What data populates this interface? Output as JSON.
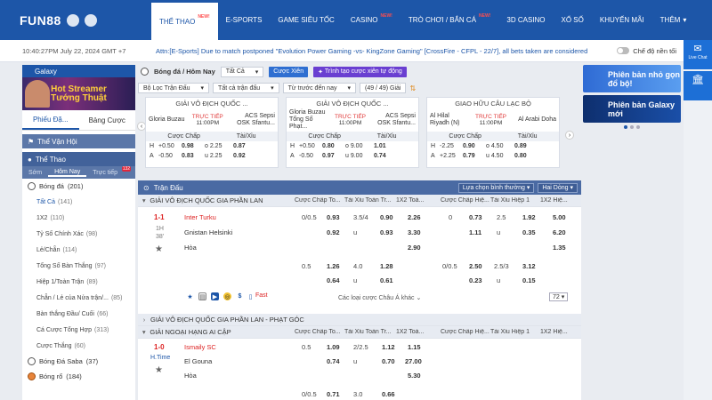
{
  "brand": {
    "logo": "FUN88"
  },
  "nav": [
    {
      "label": "THỂ THAO",
      "new": "NEW!"
    },
    {
      "label": "E-SPORTS",
      "new": ""
    },
    {
      "label": "GAME SIÊU TỐC",
      "new": ""
    },
    {
      "label": "CASINO",
      "new": "NEW!"
    },
    {
      "label": "TRÒ CHƠI / BẮN CÁ",
      "new": "NEW!"
    },
    {
      "label": "3D CASINO",
      "new": ""
    },
    {
      "label": "XỔ SỐ",
      "new": ""
    },
    {
      "label": "KHUYẾN MÃI",
      "new": ""
    },
    {
      "label": "THÊM",
      "new": ""
    }
  ],
  "info": {
    "clock": "10:40:27PM July 22, 2024 GMT +7",
    "marquee": "Attn:[E-Sports] Due to match postponed \"Evolution Power Gaming -vs- KingZone Gaming\" [CrossFire - CFPL - 22/7], all bets taken are considered",
    "toggle_label": "Chế độ nền tối"
  },
  "rail": [
    {
      "label": "Live Chat"
    },
    {
      "label": ""
    }
  ],
  "left": {
    "galaxy": "Galaxy",
    "banner": [
      "Hot Streamer",
      "Tướng Thuật"
    ],
    "tabs": [
      "Phiếu Đặ...",
      "Bảng Cược"
    ],
    "section1": "Thể Vận Hội",
    "section2": "Thể Thao",
    "subtabs": [
      "Sớm",
      "Hôm Nay",
      "Trực tiếp"
    ],
    "badge": "132",
    "sport1": {
      "label": "Bóng đá",
      "count": "(201)"
    },
    "items": [
      {
        "label": "Tất Cả",
        "count": "(141)"
      },
      {
        "label": "1X2",
        "count": "(110)"
      },
      {
        "label": "Tỷ Số Chính Xác",
        "count": "(98)"
      },
      {
        "label": "Lẻ/Chẵn",
        "count": "(114)"
      },
      {
        "label": "Tổng Số Bàn Thắng",
        "count": "(97)"
      },
      {
        "label": "Hiệp 1/Toàn Trận",
        "count": "(89)"
      },
      {
        "label": "Chẵn / Lẻ của Nửa trận/...",
        "count": "(85)"
      },
      {
        "label": "Bàn thắng Đầu/ Cuối",
        "count": "(66)"
      },
      {
        "label": "Cá Cược Tổng Hợp",
        "count": "(313)"
      },
      {
        "label": "Cược Thắng",
        "count": "(60)"
      }
    ],
    "sport2": {
      "label": "Bóng Đá Saba",
      "count": "(37)"
    },
    "sport3": {
      "label": "Bóng rổ",
      "count": "(184)"
    }
  },
  "center": {
    "title": "Bóng đá / Hôm Nay",
    "all": "Tất Cả",
    "btn1": "Cược Xiên",
    "btn2": "Trình tạo cược xiên tự động",
    "filter1": "Bộ Lọc Trận Đấu",
    "filter2": "Tất cả trận đấu",
    "filter3": "Từ trước đến nay",
    "page": "(49 / 49) Giải",
    "cards": [
      {
        "league": "GIẢI VÔ ĐỊCH QUỐC ...",
        "home": "Gloria Buzau",
        "away": "ACS Sepsi OSK Sfantu...",
        "live": "TRỰC TIẾP",
        "time": "11:00PM",
        "h": [
          "H",
          "+0.50",
          "0.98",
          "o 2.25",
          "0.87"
        ],
        "a": [
          "A",
          "-0.50",
          "0.83",
          "u 2.25",
          "0.92"
        ]
      },
      {
        "league": "GIẢI VÔ ĐỊCH QUỐC ...",
        "home": "Gloria Buzau Tổng Số Phạt...",
        "away": "ACS Sepsi OSK Sfantu...",
        "live": "TRỰC TIẾP",
        "time": "11:00PM",
        "h": [
          "H",
          "+0.50",
          "0.80",
          "o 9.00",
          "1.01"
        ],
        "a": [
          "A",
          "-0.50",
          "0.97",
          "u 9.00",
          "0.74"
        ]
      },
      {
        "league": "GIAO HỮU CÂU LẠC BỘ",
        "home": "Al Hilal Riyadh (N)",
        "away": "Al Arabi Doha",
        "live": "TRỰC TIẾP",
        "time": "11:00PM",
        "h": [
          "H",
          "-2.25",
          "0.90",
          "o 4.50",
          "0.89"
        ],
        "a": [
          "A",
          "+2.25",
          "0.79",
          "u 4.50",
          "0.80"
        ]
      }
    ],
    "card_hdr": [
      "Cược Chấp",
      "Tài/Xỉu"
    ],
    "tran": "Trận Đấu",
    "sort": "Lựa chọn bình thường",
    "view": "Hai Dòng",
    "league1": "GIẢI VÔ ĐỊCH QUỐC GIA PHẦN LAN",
    "cols": [
      "Cược Chấp To...",
      "Tài Xỉu Toàn Tr...",
      "1X2 Toà...",
      "Cược Chấp Hiệ...",
      "Tài Xỉu Hiệp 1",
      "1X2 Hiệ..."
    ],
    "m1": {
      "score": "1-1",
      "period": "1H",
      "min": "38'",
      "home": "Inter Turku",
      "away": "Gnistan Helsinki",
      "draw": "Hòa"
    },
    "m1r1": [
      "0/0.5",
      "0.93",
      "3.5/4",
      "0.90",
      "2.26",
      "0",
      "0.73",
      "2.5",
      "1.92",
      "5.00"
    ],
    "m1r2": [
      "0.92",
      "u",
      "0.93",
      "3.30",
      "1.11",
      "u",
      "0.35",
      "6.20"
    ],
    "m1r3": [
      "2.90",
      "1.35"
    ],
    "m1r4": [
      "0.5",
      "1.26",
      "4.0",
      "1.28",
      "0/0.5",
      "2.50",
      "2.5/3",
      "3.12"
    ],
    "m1r5": [
      "0.64",
      "u",
      "0.61",
      "0.23",
      "u",
      "0.15"
    ],
    "more": "Các loại cược Châu Á khác",
    "more_count": "72",
    "fast": "Fast",
    "league2": "GIẢI VÔ ĐỊCH QUỐC GIA PHẦN LAN - PHẠT GÓC",
    "league3": "GIẢI NGOẠI HẠNG AI CẬP",
    "m2": {
      "score": "1-0",
      "period": "H.Time",
      "home": "Ismaily SC",
      "away": "El Gouna",
      "draw": "Hòa"
    },
    "m2r1": [
      "0.5",
      "1.09",
      "2/2.5",
      "1.12",
      "1.15"
    ],
    "m2r2": [
      "0.74",
      "u",
      "0.70",
      "27.00"
    ],
    "m2r3": [
      "5.30"
    ],
    "m2r4": [
      "0/0.5",
      "0.71",
      "3.0",
      "0.66"
    ]
  },
  "right": {
    "promo1": "Phiên bản nhỏ gọn đổ bộ!",
    "promo2": "Phiên bản Galaxy mới"
  }
}
